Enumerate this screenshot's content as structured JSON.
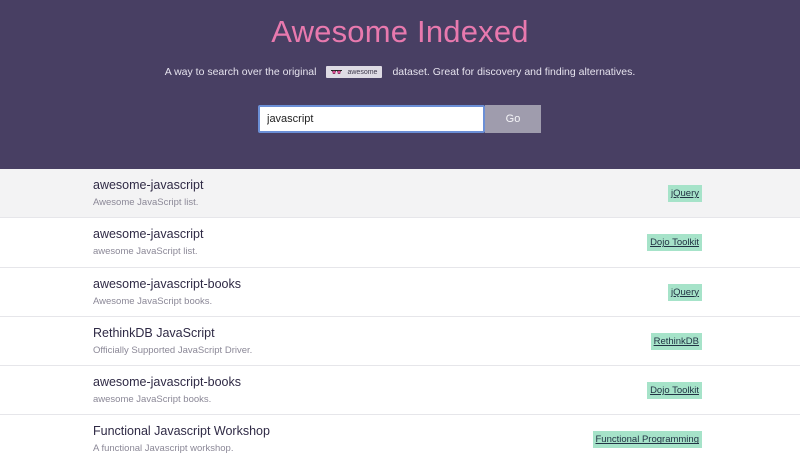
{
  "header": {
    "title": "Awesome Indexed",
    "tagline_before": "A way to search over the original",
    "badge_label": "awesome",
    "tagline_after": "dataset. Great for discovery and finding alternatives.",
    "title_color": "#e879ae",
    "background_color": "#483f63"
  },
  "search": {
    "value": "javascript",
    "button_label": "Go"
  },
  "results": [
    {
      "name": "awesome-javascript",
      "description": "Awesome JavaScript list.",
      "tag": "jQuery"
    },
    {
      "name": "awesome-javascript",
      "description": "awesome JavaScript list.",
      "tag": "Dojo Toolkit"
    },
    {
      "name": "awesome-javascript-books",
      "description": "Awesome JavaScript books.",
      "tag": "jQuery"
    },
    {
      "name": "RethinkDB JavaScript",
      "description": "Officially Supported JavaScript Driver.",
      "tag": "RethinkDB"
    },
    {
      "name": "awesome-javascript-books",
      "description": "awesome JavaScript books.",
      "tag": "Dojo Toolkit"
    },
    {
      "name": "Functional Javascript Workshop",
      "description": "A functional Javascript workshop.",
      "tag": "Functional Programming"
    }
  ],
  "tag_color": "#a6e3c9"
}
